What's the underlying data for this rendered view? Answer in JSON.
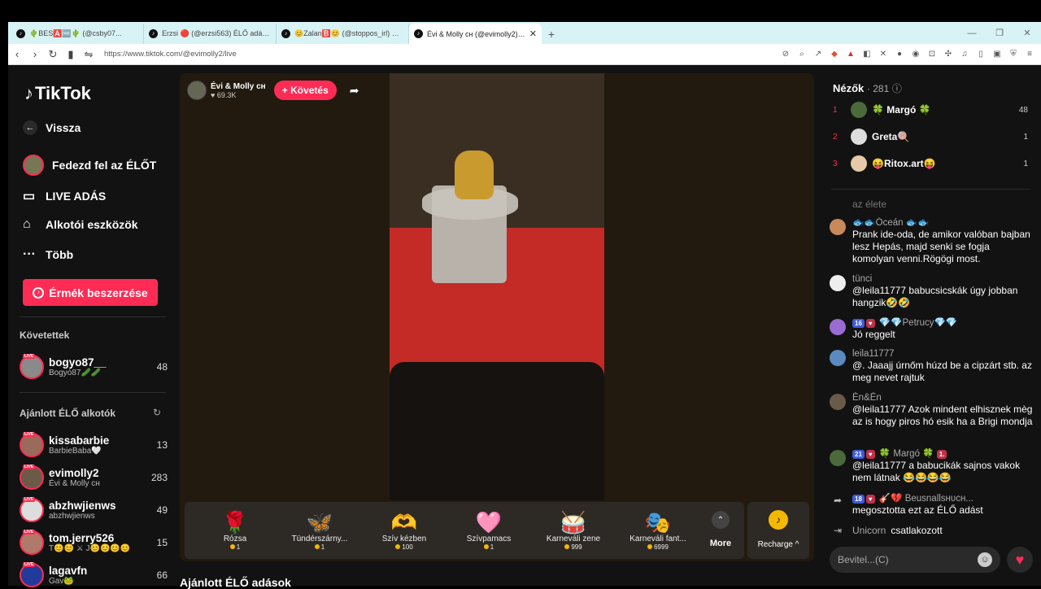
{
  "browser": {
    "tabs": [
      {
        "title": "🌵BES🅰️🆓🌵 (@csby07...",
        "active": false
      },
      {
        "title": "Erzsi 🔴 (@erzsi563) ÉLŐ adásban van",
        "active": false
      },
      {
        "title": "😊Zalan🅱️😊 (@stoppos_irl) ÉLŐ adás",
        "active": false
      },
      {
        "title": "Évi & Molly ᴄʜ (@evimolly2) ÉLŐ",
        "active": true
      }
    ],
    "url": "https://www.tiktok.com/@evimolly2/live"
  },
  "sidebar": {
    "logo": "TikTok",
    "back": "Vissza",
    "explore": "Fedezd fel az ÉLŐT",
    "live": "LIVE ADÁS",
    "creator_tools": "Alkotói eszközök",
    "more": "Több",
    "coins_button": "Érmék beszerzése",
    "following_title": "Követettek",
    "following": [
      {
        "name": "bogyo87__",
        "sub": "Bogyó87🥒🥒",
        "count": "48",
        "color": "#8a8a8a"
      }
    ],
    "recommended_title": "Ajánlott ÉLŐ alkotók",
    "recommended": [
      {
        "name": "kissabarbie",
        "sub": "BarbieBaba🤍",
        "count": "13",
        "color": "#9a6b5a"
      },
      {
        "name": "evimolly2",
        "sub": "Évi & Molly ᴄʜ",
        "count": "283",
        "color": "#6b5a48"
      },
      {
        "name": "abzhwjienws",
        "sub": "abzhwjienws",
        "count": "49",
        "color": "#dddddd"
      },
      {
        "name": "tom.jerry526",
        "sub": "T😊😊 ⚔ J😊😊😊😊",
        "count": "15",
        "color": "#b07a6a"
      },
      {
        "name": "lagavfn",
        "sub": "Gav🐸",
        "count": "66",
        "color": "#223a9a"
      }
    ],
    "live_badge": "LIVE"
  },
  "stream": {
    "name": "Évi & Molly ᴄʜ",
    "likes": "69.3K",
    "follow": "+ Követés",
    "gifts": [
      {
        "icon": "🌹",
        "name": "Rózsa",
        "price": "1"
      },
      {
        "icon": "🦋",
        "name": "Tündérszárny...",
        "price": "1"
      },
      {
        "icon": "🫶",
        "name": "Szív kézben",
        "price": "100"
      },
      {
        "icon": "🩷",
        "name": "Szívpamacs",
        "price": "1"
      },
      {
        "icon": "🥁",
        "name": "Karneváli zene",
        "price": "999"
      },
      {
        "icon": "🎭",
        "name": "Karneváli fant...",
        "price": "6999"
      }
    ],
    "more": "More",
    "recharge": "Recharge ^",
    "recommended_title": "Ajánlott ÉLŐ adások"
  },
  "chat": {
    "viewers_label": "Nézők",
    "viewers_count": "· 281",
    "top_viewers": [
      {
        "rank": "1",
        "name": "🍀 Margó 🍀",
        "count": "48",
        "color": "#4a6a3a"
      },
      {
        "rank": "2",
        "name": "Greta🍭",
        "count": "1",
        "color": "#ddd"
      },
      {
        "rank": "3",
        "name": "😝Ritox.art😝",
        "count": "1",
        "color": "#e7c9a9"
      }
    ],
    "faded": "az élete",
    "messages": [
      {
        "user": "🐟🐟Óceán 🐟🐟",
        "text": "Prank ide-oda, de amikor valóban bajban lesz Hepás, majd senki se fogja komolyan venni.Rögögi most.",
        "color": "#c88a5a",
        "badges": []
      },
      {
        "user": "tünci",
        "text": "@leila11777 babucsicskák úgy jobban hangzik🤣🤣",
        "color": "#eee",
        "badges": []
      },
      {
        "user": "💎💎Petrucy💎💎",
        "text": "Jó reggelt",
        "color": "#9a6bd0",
        "badges": [
          "16",
          "♥"
        ]
      },
      {
        "user": "leila11777",
        "text": "@. Jaaajj úrnőm húzd be a cipzárt stb. az meg nevet rajtuk",
        "color": "#5a8ac0",
        "badges": []
      },
      {
        "user": "Én&Én",
        "text": "@leila11777 Azok mindent elhisznek mèg az is hogy piros hó esik ha a Brigi mondja",
        "color": "#6a5a4a",
        "badges": []
      },
      {
        "user": "🍀 Margó 🍀",
        "text": "@leila11777 a babucikák sajnos vakok nem látnak 😂😂😂😂",
        "color": "#4a6a3a",
        "badges": [
          "21",
          "♥"
        ],
        "extra": "1."
      }
    ],
    "share_user": "🎸💔 Beusnallsʜᴜᴄʜ...",
    "share_text": "megosztotta ezt az ÉLŐ adást",
    "share_badges": [
      "18",
      "♥"
    ],
    "join_user": "Unicorn",
    "join_text": "csatlakozott",
    "input_placeholder": "Bevitel...(C)"
  }
}
